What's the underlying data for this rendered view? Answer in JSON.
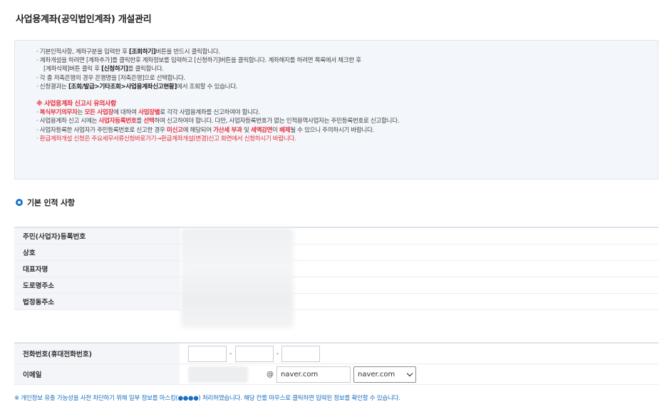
{
  "page_title": "사업용계좌(공익법인계좌) 개설관리",
  "notice": {
    "l1_pre": "기본인적사항, 계좌구분을 입력한 후 ",
    "l1_b": "[조회하기]",
    "l1_post": "버튼을 반드시 클릭합니다.",
    "l2": "계좌개설을 하려면 [계좌추가]를 클릭한후 계좌정보를 입력하고 [신청하기]버튼을 클릭합니다. 계좌해지를 하려면 목록에서 체크한 후",
    "l3_pre": "[계좌삭제]버튼 클릭 후 ",
    "l3_b": "[신청하기]",
    "l3_post": "를 클릭합니다.",
    "l4": "각 종 저축은행의 경우 은행명을 [저축은행]으로 선택합니다.",
    "l5_pre": "신청결과는 ",
    "l5_b": "[조회/발급>기타조회>사업용계좌신고현황]",
    "l5_post": "에서 조회할 수 있습니다.",
    "warn_title": "※ 사업용계좌 신고시 유의사항",
    "w1_r1": "복식부기의무자",
    "w1_t1": "는 ",
    "w1_r2": "모든 사업장",
    "w1_t2": "에 대하여 ",
    "w1_r3": "사업장별",
    "w1_t3": "로 각각 사업용계좌를 신고하여야 합니다.",
    "w2_t1": "사업용계좌 신고 시에는 ",
    "w2_r1": "사업자등록번호",
    "w2_t2": "를 ",
    "w2_r2": "선택",
    "w2_t3": "하여 신고하여야 합니다. 다만, 사업자등록번호가 없는 인적용역사업자는 주민등록번호로 신고합니다.",
    "w3_t1": "사업자등록한 사업자가 주민등록번호로 신고한 경우 ",
    "w3_r1": "미신고",
    "w3_t2": "에 해당되어 ",
    "w3_r2": "가산세 부과",
    "w3_t3": " 및 ",
    "w3_r3": "세액감면",
    "w3_t4": "이 ",
    "w3_r4": "배제",
    "w3_t5": "될 수 있으니 주의하시기 바랍니다.",
    "w4": "환급계좌개설 신청은 주요세무서류신청바로가기→환급계좌개설(변경)신고 화면에서 신청하시기 바랍니다."
  },
  "section_title": "기본 인적 사항",
  "fields": {
    "resident_no": "주민(사업자)등록번호",
    "trade_name": "상호",
    "representative": "대표자명",
    "road_address": "도로명주소",
    "legal_address": "법정동주소",
    "phone": "전화번호(휴대전화번호)",
    "email": "이메일"
  },
  "phone": {
    "sep1": "-",
    "sep2": "-"
  },
  "email": {
    "at": "@",
    "domain_value": "naver.com",
    "domain_select": "naver.com"
  },
  "footnote": "※ 개인정보 유출 가능성을 사전 차단하기 위해 일부 정보를 마스킹(●●●●) 처리하였습니다. 해당 칸를 마우스로 클릭하면 입력된 정보를 확인할 수 있습니다."
}
